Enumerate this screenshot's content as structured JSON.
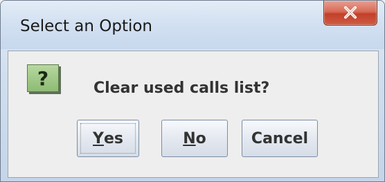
{
  "window": {
    "title": "Select an Option"
  },
  "dialog": {
    "message": "Clear used calls list?",
    "icon_glyph": "?",
    "icon_name": "question-icon"
  },
  "buttons": {
    "yes": {
      "mnemonic": "Y",
      "rest": "es"
    },
    "no": {
      "mnemonic": "N",
      "rest": "o"
    },
    "cancel": {
      "label": "Cancel"
    }
  },
  "colors": {
    "close_button": "#d86a55",
    "question_icon": "#8dbb74",
    "titlebar": "#d2e0f1"
  }
}
